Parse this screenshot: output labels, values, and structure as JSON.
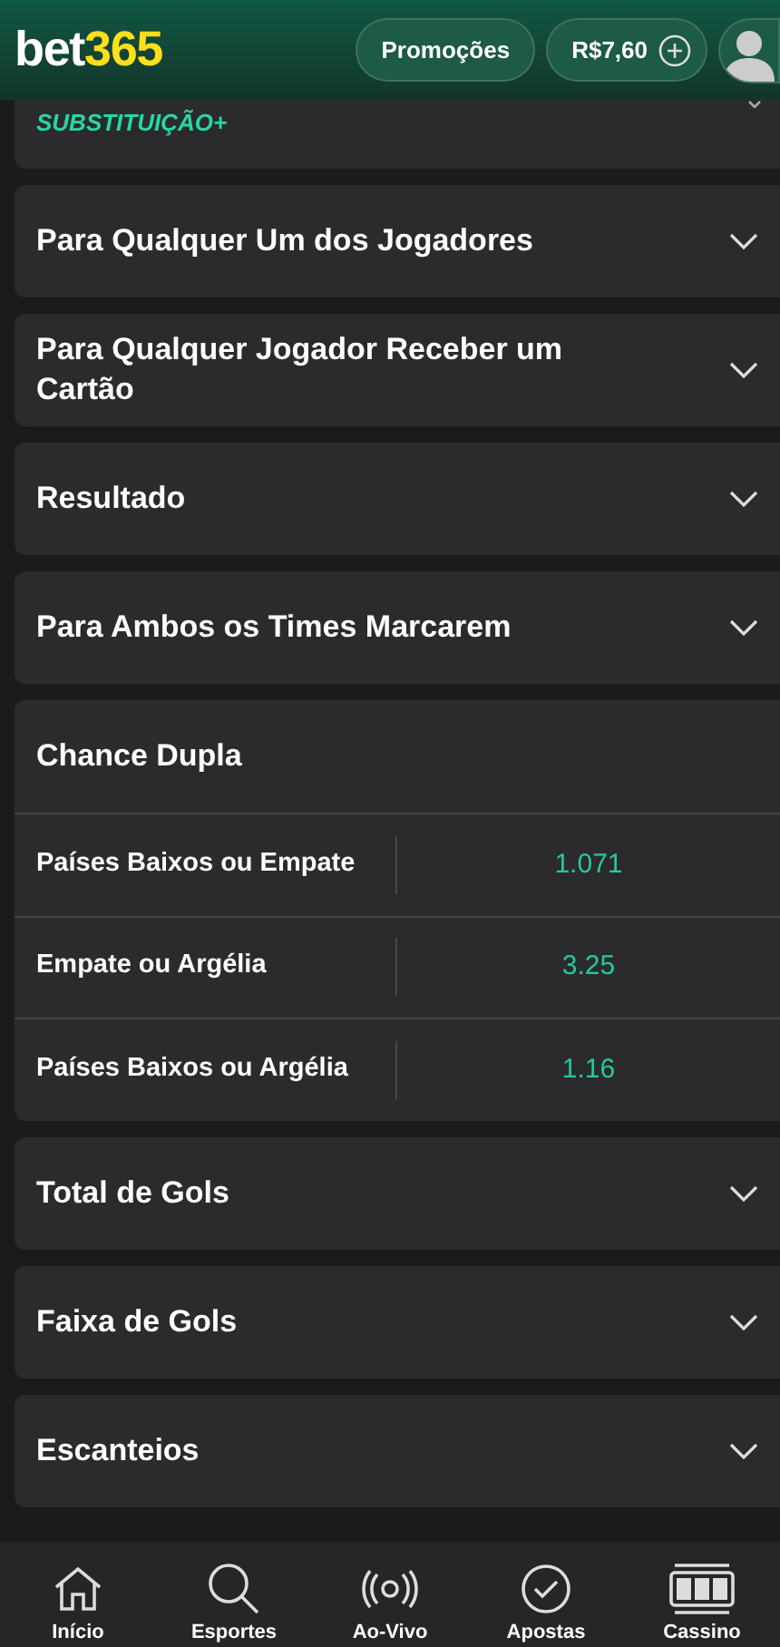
{
  "header": {
    "logo_part_1": "bet",
    "logo_part_2": "365",
    "promo_button": "Promoções",
    "balance": "R$7,60"
  },
  "top_card": {
    "label": "SUBSTITUIÇÃO+"
  },
  "markets": [
    {
      "title": "Para Qualquer Um dos Jogadores",
      "expanded": false
    },
    {
      "title": "Para Qualquer Jogador Receber um Cartão",
      "expanded": false
    },
    {
      "title": "Resultado",
      "expanded": false
    },
    {
      "title": "Para Ambos os Times Marcarem",
      "expanded": false
    },
    {
      "title": "Chance Dupla",
      "expanded": true,
      "selections": [
        {
          "name": "Países Baixos ou Empate",
          "odds": "1.071"
        },
        {
          "name": "Empate ou Argélia",
          "odds": "3.25"
        },
        {
          "name": "Países Baixos ou Argélia",
          "odds": "1.16"
        }
      ]
    },
    {
      "title": "Total de Gols",
      "expanded": false
    },
    {
      "title": "Faixa de Gols",
      "expanded": false
    },
    {
      "title": "Escanteios",
      "expanded": false
    }
  ],
  "nav": [
    {
      "kind": "home",
      "label": "Início"
    },
    {
      "kind": "search",
      "label": "Esportes"
    },
    {
      "kind": "live",
      "label": "Ao-Vivo"
    },
    {
      "kind": "bets",
      "label": "Apostas"
    },
    {
      "kind": "casino",
      "label": "Cassino"
    }
  ]
}
